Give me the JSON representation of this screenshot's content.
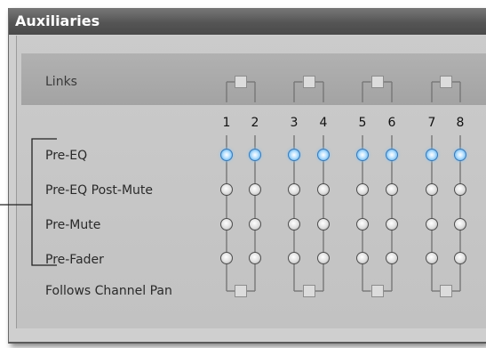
{
  "window": {
    "title": "Auxiliaries"
  },
  "links": {
    "label": "Links"
  },
  "channels": [
    "1",
    "2",
    "3",
    "4",
    "5",
    "6",
    "7",
    "8"
  ],
  "rows": [
    {
      "label": "Pre-EQ",
      "selected": [
        true,
        true,
        true,
        true,
        true,
        true,
        true,
        true
      ]
    },
    {
      "label": "Pre-EQ Post-Mute",
      "selected": [
        false,
        false,
        false,
        false,
        false,
        false,
        false,
        false
      ]
    },
    {
      "label": "Pre-Mute",
      "selected": [
        false,
        false,
        false,
        false,
        false,
        false,
        false,
        false
      ]
    },
    {
      "label": "Pre-Fader",
      "selected": [
        false,
        false,
        false,
        false,
        false,
        false,
        false,
        false
      ]
    }
  ],
  "follows_pan": {
    "label": "Follows Channel Pan"
  },
  "colors": {
    "selected_radio": "#6fb8ef",
    "titlebar": "#555555"
  }
}
